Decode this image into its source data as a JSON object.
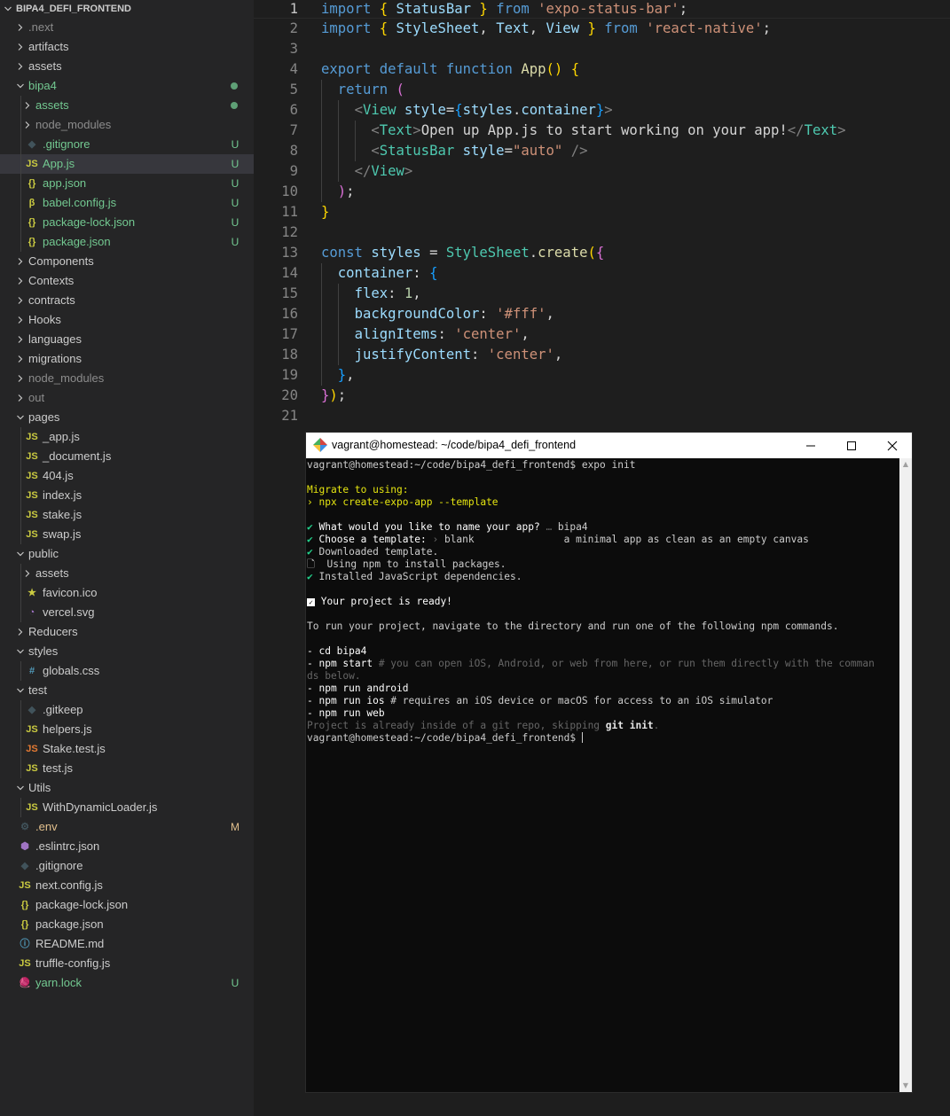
{
  "explorer": {
    "root_label": "BIPA4_DEFI_FRONTEND",
    "items": [
      {
        "label": ".next",
        "kind": "folder",
        "depth": 0,
        "expanded": false,
        "color": "ignored"
      },
      {
        "label": "artifacts",
        "kind": "folder",
        "depth": 0,
        "expanded": false
      },
      {
        "label": "assets",
        "kind": "folder",
        "depth": 0,
        "expanded": false
      },
      {
        "label": "bipa4",
        "kind": "folder",
        "depth": 0,
        "expanded": true,
        "color": "untracked",
        "dot": true
      },
      {
        "label": "assets",
        "kind": "folder",
        "depth": 1,
        "expanded": false,
        "color": "untracked",
        "dot": true
      },
      {
        "label": "node_modules",
        "kind": "folder",
        "depth": 1,
        "expanded": false,
        "color": "ignored"
      },
      {
        "label": ".gitignore",
        "kind": "file",
        "icon": "git-icon",
        "depth": 1,
        "color": "untracked",
        "badge": "U"
      },
      {
        "label": "App.js",
        "kind": "file",
        "icon": "js-icon",
        "depth": 1,
        "color": "untracked",
        "badge": "U",
        "selected": true
      },
      {
        "label": "app.json",
        "kind": "file",
        "icon": "json-icon",
        "depth": 1,
        "color": "untracked",
        "badge": "U"
      },
      {
        "label": "babel.config.js",
        "kind": "file",
        "icon": "babel-icon",
        "depth": 1,
        "color": "untracked",
        "badge": "U"
      },
      {
        "label": "package-lock.json",
        "kind": "file",
        "icon": "json-icon",
        "depth": 1,
        "color": "untracked",
        "badge": "U"
      },
      {
        "label": "package.json",
        "kind": "file",
        "icon": "json-icon",
        "depth": 1,
        "color": "untracked",
        "badge": "U"
      },
      {
        "label": "Components",
        "kind": "folder",
        "depth": 0,
        "expanded": false
      },
      {
        "label": "Contexts",
        "kind": "folder",
        "depth": 0,
        "expanded": false
      },
      {
        "label": "contracts",
        "kind": "folder",
        "depth": 0,
        "expanded": false
      },
      {
        "label": "Hooks",
        "kind": "folder",
        "depth": 0,
        "expanded": false
      },
      {
        "label": "languages",
        "kind": "folder",
        "depth": 0,
        "expanded": false
      },
      {
        "label": "migrations",
        "kind": "folder",
        "depth": 0,
        "expanded": false
      },
      {
        "label": "node_modules",
        "kind": "folder",
        "depth": 0,
        "expanded": false,
        "color": "ignored"
      },
      {
        "label": "out",
        "kind": "folder",
        "depth": 0,
        "expanded": false,
        "color": "ignored"
      },
      {
        "label": "pages",
        "kind": "folder",
        "depth": 0,
        "expanded": true
      },
      {
        "label": "_app.js",
        "kind": "file",
        "icon": "js-icon",
        "depth": 1
      },
      {
        "label": "_document.js",
        "kind": "file",
        "icon": "js-icon",
        "depth": 1
      },
      {
        "label": "404.js",
        "kind": "file",
        "icon": "js-icon",
        "depth": 1
      },
      {
        "label": "index.js",
        "kind": "file",
        "icon": "js-icon",
        "depth": 1
      },
      {
        "label": "stake.js",
        "kind": "file",
        "icon": "js-icon",
        "depth": 1
      },
      {
        "label": "swap.js",
        "kind": "file",
        "icon": "js-icon",
        "depth": 1
      },
      {
        "label": "public",
        "kind": "folder",
        "depth": 0,
        "expanded": true
      },
      {
        "label": "assets",
        "kind": "folder",
        "depth": 1,
        "expanded": false
      },
      {
        "label": "favicon.ico",
        "kind": "file",
        "icon": "star-icon",
        "depth": 1
      },
      {
        "label": "vercel.svg",
        "kind": "file",
        "icon": "svg-icon",
        "depth": 1
      },
      {
        "label": "Reducers",
        "kind": "folder",
        "depth": 0,
        "expanded": false
      },
      {
        "label": "styles",
        "kind": "folder",
        "depth": 0,
        "expanded": true
      },
      {
        "label": "globals.css",
        "kind": "file",
        "icon": "css-icon",
        "depth": 1
      },
      {
        "label": "test",
        "kind": "folder",
        "depth": 0,
        "expanded": true
      },
      {
        "label": ".gitkeep",
        "kind": "file",
        "icon": "git-icon",
        "depth": 1
      },
      {
        "label": "helpers.js",
        "kind": "file",
        "icon": "js-icon",
        "depth": 1
      },
      {
        "label": "Stake.test.js",
        "kind": "file",
        "icon": "test-js-icon",
        "depth": 1
      },
      {
        "label": "test.js",
        "kind": "file",
        "icon": "js-icon",
        "depth": 1
      },
      {
        "label": "Utils",
        "kind": "folder",
        "depth": 0,
        "expanded": true
      },
      {
        "label": "WithDynamicLoader.js",
        "kind": "file",
        "icon": "js-icon",
        "depth": 1
      },
      {
        "label": ".env",
        "kind": "file",
        "icon": "gear-icon",
        "depth": 0,
        "color": "modified",
        "badge": "M"
      },
      {
        "label": ".eslintrc.json",
        "kind": "file",
        "icon": "eslint-icon",
        "depth": 0
      },
      {
        "label": ".gitignore",
        "kind": "file",
        "icon": "git-icon",
        "depth": 0
      },
      {
        "label": "next.config.js",
        "kind": "file",
        "icon": "js-icon",
        "depth": 0
      },
      {
        "label": "package-lock.json",
        "kind": "file",
        "icon": "json-icon",
        "depth": 0
      },
      {
        "label": "package.json",
        "kind": "file",
        "icon": "json-icon",
        "depth": 0
      },
      {
        "label": "README.md",
        "kind": "file",
        "icon": "info-icon",
        "depth": 0
      },
      {
        "label": "truffle-config.js",
        "kind": "file",
        "icon": "js-icon",
        "depth": 0
      },
      {
        "label": "yarn.lock",
        "kind": "file",
        "icon": "yarn-icon",
        "depth": 0,
        "color": "untracked",
        "badge": "U"
      }
    ]
  },
  "editor": {
    "active_line": 1,
    "lines": [
      [
        [
          "kw",
          "import"
        ],
        [
          "pun",
          " "
        ],
        [
          "b1",
          "{"
        ],
        [
          "pun",
          " "
        ],
        [
          "var",
          "StatusBar"
        ],
        [
          "pun",
          " "
        ],
        [
          "b1",
          "}"
        ],
        [
          "pun",
          " "
        ],
        [
          "kw",
          "from"
        ],
        [
          "pun",
          " "
        ],
        [
          "str",
          "'expo-status-bar'"
        ],
        [
          "pun",
          ";"
        ]
      ],
      [
        [
          "kw",
          "import"
        ],
        [
          "pun",
          " "
        ],
        [
          "b1",
          "{"
        ],
        [
          "pun",
          " "
        ],
        [
          "var",
          "StyleSheet"
        ],
        [
          "pun",
          ", "
        ],
        [
          "var",
          "Text"
        ],
        [
          "pun",
          ", "
        ],
        [
          "var",
          "View"
        ],
        [
          "pun",
          " "
        ],
        [
          "b1",
          "}"
        ],
        [
          "pun",
          " "
        ],
        [
          "kw",
          "from"
        ],
        [
          "pun",
          " "
        ],
        [
          "str",
          "'react-native'"
        ],
        [
          "pun",
          ";"
        ]
      ],
      [],
      [
        [
          "kw",
          "export"
        ],
        [
          "pun",
          " "
        ],
        [
          "kw",
          "default"
        ],
        [
          "pun",
          " "
        ],
        [
          "kw",
          "function"
        ],
        [
          "pun",
          " "
        ],
        [
          "fn",
          "App"
        ],
        [
          "b1",
          "()"
        ],
        [
          "pun",
          " "
        ],
        [
          "b1",
          "{"
        ]
      ],
      [
        [
          "pun",
          "  "
        ],
        [
          "kw",
          "return"
        ],
        [
          "pun",
          " "
        ],
        [
          "b2",
          "("
        ]
      ],
      [
        [
          "pun",
          "    "
        ],
        [
          "tag",
          "<"
        ],
        [
          "jsx",
          "View"
        ],
        [
          "pun",
          " "
        ],
        [
          "var",
          "style"
        ],
        [
          "pun",
          "="
        ],
        [
          "b3",
          "{"
        ],
        [
          "var",
          "styles"
        ],
        [
          "pun",
          "."
        ],
        [
          "var",
          "container"
        ],
        [
          "b3",
          "}"
        ],
        [
          "tag",
          ">"
        ]
      ],
      [
        [
          "pun",
          "      "
        ],
        [
          "tag",
          "<"
        ],
        [
          "jsx",
          "Text"
        ],
        [
          "tag",
          ">"
        ],
        [
          "txt",
          "Open up App.js to start working on your app!"
        ],
        [
          "tag",
          "</"
        ],
        [
          "jsx",
          "Text"
        ],
        [
          "tag",
          ">"
        ]
      ],
      [
        [
          "pun",
          "      "
        ],
        [
          "tag",
          "<"
        ],
        [
          "jsx",
          "StatusBar"
        ],
        [
          "pun",
          " "
        ],
        [
          "var",
          "style"
        ],
        [
          "pun",
          "="
        ],
        [
          "str",
          "\"auto\""
        ],
        [
          "pun",
          " "
        ],
        [
          "tag",
          "/>"
        ]
      ],
      [
        [
          "pun",
          "    "
        ],
        [
          "tag",
          "</"
        ],
        [
          "jsx",
          "View"
        ],
        [
          "tag",
          ">"
        ]
      ],
      [
        [
          "pun",
          "  "
        ],
        [
          "b2",
          ")"
        ],
        [
          "pun",
          ";"
        ]
      ],
      [
        [
          "b1",
          "}"
        ]
      ],
      [],
      [
        [
          "kw",
          "const"
        ],
        [
          "pun",
          " "
        ],
        [
          "var",
          "styles"
        ],
        [
          "pun",
          " = "
        ],
        [
          "type",
          "StyleSheet"
        ],
        [
          "pun",
          "."
        ],
        [
          "fn",
          "create"
        ],
        [
          "b1",
          "("
        ],
        [
          "b2",
          "{"
        ]
      ],
      [
        [
          "pun",
          "  "
        ],
        [
          "var",
          "container"
        ],
        [
          "pun",
          ": "
        ],
        [
          "b3",
          "{"
        ]
      ],
      [
        [
          "pun",
          "    "
        ],
        [
          "var",
          "flex"
        ],
        [
          "pun",
          ": "
        ],
        [
          "num",
          "1"
        ],
        [
          "pun",
          ","
        ]
      ],
      [
        [
          "pun",
          "    "
        ],
        [
          "var",
          "backgroundColor"
        ],
        [
          "pun",
          ": "
        ],
        [
          "str",
          "'#fff'"
        ],
        [
          "pun",
          ","
        ]
      ],
      [
        [
          "pun",
          "    "
        ],
        [
          "var",
          "alignItems"
        ],
        [
          "pun",
          ": "
        ],
        [
          "str",
          "'center'"
        ],
        [
          "pun",
          ","
        ]
      ],
      [
        [
          "pun",
          "    "
        ],
        [
          "var",
          "justifyContent"
        ],
        [
          "pun",
          ": "
        ],
        [
          "str",
          "'center'"
        ],
        [
          "pun",
          ","
        ]
      ],
      [
        [
          "pun",
          "  "
        ],
        [
          "b3",
          "}"
        ],
        [
          "pun",
          ","
        ]
      ],
      [
        [
          "b2",
          "}"
        ],
        [
          "b1",
          ")"
        ],
        [
          "pun",
          ";"
        ]
      ],
      []
    ]
  },
  "terminal": {
    "title": "vagrant@homestead: ~/code/bipa4_defi_frontend",
    "lines": [
      [
        [
          "plain",
          "vagrant@homestead:~/code/bipa4_defi_frontend$ expo init"
        ]
      ],
      [],
      [
        [
          "yellow",
          "Migrate to using:"
        ]
      ],
      [
        [
          "yellow",
          "› npx create-expo-app --template"
        ]
      ],
      [],
      [
        [
          "green",
          "✔ "
        ],
        [
          "white",
          "What would you like to name your app?"
        ],
        [
          "dim",
          " … "
        ],
        [
          "plain",
          "bipa4"
        ]
      ],
      [
        [
          "green",
          "✔ "
        ],
        [
          "white",
          "Choose a template:"
        ],
        [
          "dim",
          " › "
        ],
        [
          "plain",
          "blank               a minimal app as clean as an empty canvas"
        ]
      ],
      [
        [
          "green",
          "✔ "
        ],
        [
          "plain",
          "Downloaded template."
        ]
      ],
      [
        [
          "plain",
          "🗋  Using npm to install packages."
        ]
      ],
      [
        [
          "green",
          "✔ "
        ],
        [
          "plain",
          "Installed JavaScript dependencies."
        ]
      ],
      [],
      [
        [
          "check",
          "✓"
        ],
        [
          "white",
          " Your project is ready!"
        ]
      ],
      [],
      [
        [
          "plain",
          "To run your project, navigate to the directory and run one of the following npm commands."
        ]
      ],
      [],
      [
        [
          "white",
          "- cd bipa4"
        ]
      ],
      [
        [
          "white",
          "- npm start "
        ],
        [
          "dim",
          "# you can open iOS, Android, or web from here, or run them directly with the comman"
        ]
      ],
      [
        [
          "dim",
          "ds below."
        ]
      ],
      [
        [
          "white",
          "- npm run android"
        ]
      ],
      [
        [
          "white",
          "- npm run ios "
        ],
        [
          "plain",
          "# requires an iOS device or macOS for access to an iOS simulator"
        ]
      ],
      [
        [
          "white",
          "- npm run web"
        ]
      ],
      [
        [
          "dim",
          "Project is already inside of a git repo, skipping "
        ],
        [
          "bold",
          "git init"
        ],
        [
          "dim",
          "."
        ]
      ],
      [
        [
          "plain",
          "vagrant@homestead:~/code/bipa4_defi_frontend$ "
        ],
        [
          "cursor",
          ""
        ]
      ]
    ]
  },
  "colors": {
    "untracked": "#73c991",
    "modified": "#e2c08d",
    "ignored": "#8c8c8c",
    "js": "#cbcb41",
    "json": "#cbcb41",
    "git": "#41535b",
    "test_js": "#e37933",
    "css": "#519aba",
    "info": "#519aba",
    "eslint": "#a074c4",
    "yarn": "#519aba"
  }
}
